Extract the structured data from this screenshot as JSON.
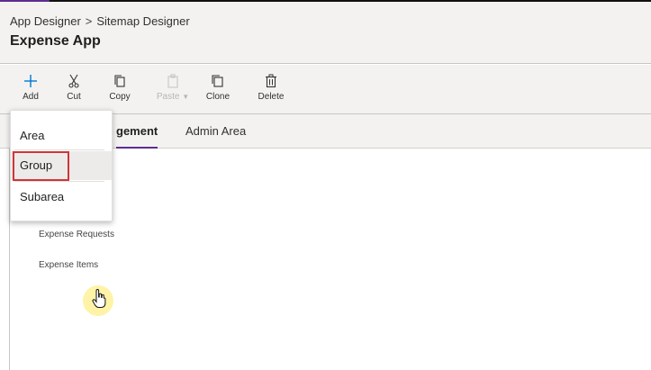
{
  "header": {
    "breadcrumb_root": "App Designer",
    "breadcrumb_separator": ">",
    "breadcrumb_current": "Sitemap Designer",
    "app_title": "Expense App"
  },
  "toolbar": {
    "add": "Add",
    "cut": "Cut",
    "copy": "Copy",
    "paste": "Paste",
    "clone": "Clone",
    "delete": "Delete"
  },
  "tabs": [
    {
      "label": "Expense Management",
      "visible_text": "gement",
      "active": true
    },
    {
      "label": "Admin Area",
      "active": false
    }
  ],
  "add_menu": {
    "items": [
      "Area",
      "Group",
      "Subarea"
    ],
    "highlighted": "Group"
  },
  "subareas": [
    "Expense Requests",
    "Expense Items"
  ],
  "colors": {
    "accent": "#5c2d91",
    "add_icon": "#0078d4",
    "highlight_outline": "#d13438",
    "cursor_halo": "#ffec78"
  },
  "icons": [
    "plus-icon",
    "scissors-icon",
    "copy-icon",
    "paste-icon",
    "clone-icon",
    "trash-icon",
    "hand-cursor-icon"
  ]
}
